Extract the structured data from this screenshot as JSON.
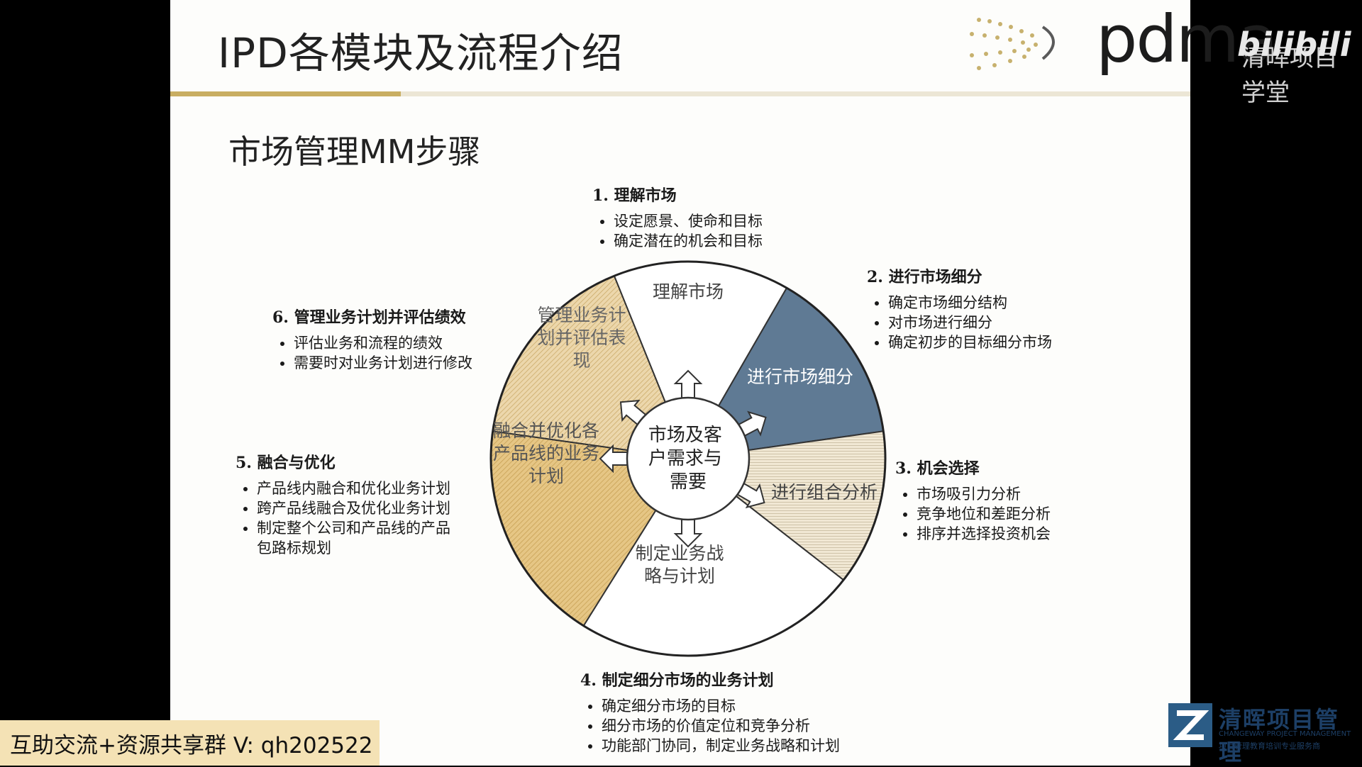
{
  "slide": {
    "title": "IPD各模块及流程介绍",
    "section_title": "市场管理MM步骤"
  },
  "watermark": {
    "pdma": "pdma",
    "subtitle": "清晖项目学堂",
    "bilibili": "bilibili"
  },
  "wheel": {
    "center_label": [
      "市场及客",
      "户需求与",
      "需要"
    ],
    "segments": [
      {
        "label": [
          "理解市场"
        ],
        "fill": "#ffffff"
      },
      {
        "label": [
          "进行市场细分"
        ],
        "fill": "#5f7a94"
      },
      {
        "label": [
          "进行组合分析"
        ],
        "fill": "#e9dcc0"
      },
      {
        "label": [
          "制定业务战",
          "略与计划"
        ],
        "fill": "#ffffff"
      },
      {
        "label": [
          "融合并优化各",
          "产品线的业务",
          "计划"
        ],
        "fill": "#e3c587"
      },
      {
        "label": [
          "管理业务计",
          "划并评估表",
          "现"
        ],
        "fill": "#e6d3a8"
      }
    ]
  },
  "steps": [
    {
      "title": "1. 理解市场",
      "bullets": [
        "设定愿景、使命和目标",
        "确定潜在的机会和目标"
      ]
    },
    {
      "title": "2. 进行市场细分",
      "bullets": [
        "确定市场细分结构",
        "对市场进行细分",
        "确定初步的目标细分市场"
      ]
    },
    {
      "title": "3. 机会选择",
      "bullets": [
        "市场吸引力分析",
        "竞争地位和差距分析",
        "排序并选择投资机会"
      ]
    },
    {
      "title": "4. 制定细分市场的业务计划",
      "bullets": [
        "确定细分市场的目标",
        "细分市场的价值定位和竞争分析",
        "功能部门协同，制定业务战略和计划"
      ]
    },
    {
      "title": "5. 融合与优化",
      "bullets": [
        "产品线内融合和优化业务计划",
        "跨产品线融合及优化业务计划",
        "制定整个公司和产品线的产品",
        "包路标规划"
      ]
    },
    {
      "title": "6. 管理业务计划并评估绩效",
      "bullets": [
        "评估业务和流程的绩效",
        "需要时对业务计划进行修改"
      ]
    }
  ],
  "footer": {
    "group_text": "互助交流+资源共享群 V: qh202522",
    "brand_name": "清晖项目管理",
    "brand_en": "CHANGEWAY PROJECT MANAGEMENT",
    "brand_cn": "项目管理教育培训专业服务商"
  }
}
